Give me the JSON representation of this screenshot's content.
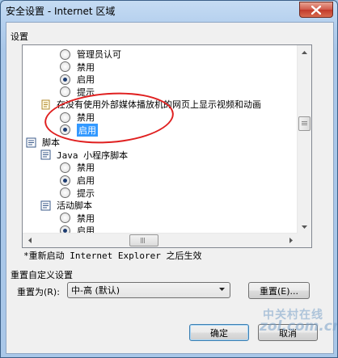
{
  "window": {
    "title": "安全设置 - Internet 区域"
  },
  "settings": {
    "group_label": "设置",
    "rows": [
      {
        "type": "radio",
        "label": "管理员认可",
        "checked": false
      },
      {
        "type": "radio",
        "label": "禁用",
        "checked": false
      },
      {
        "type": "radio",
        "label": "启用",
        "checked": true
      },
      {
        "type": "radio",
        "label": "提示",
        "checked": false
      },
      {
        "type": "setting",
        "label": "在没有使用外部媒体播放机的网页上显示视频和动画"
      },
      {
        "type": "radio",
        "label": "禁用",
        "checked": false
      },
      {
        "type": "radio",
        "label": "启用",
        "checked": true,
        "selected": true
      },
      {
        "type": "group",
        "label": "脚本"
      },
      {
        "type": "setting",
        "label": "Java 小程序脚本"
      },
      {
        "type": "radio",
        "label": "禁用",
        "checked": false
      },
      {
        "type": "radio",
        "label": "启用",
        "checked": true
      },
      {
        "type": "radio",
        "label": "提示",
        "checked": false
      },
      {
        "type": "setting",
        "label": "活动脚本"
      },
      {
        "type": "radio",
        "label": "禁用",
        "checked": false
      },
      {
        "type": "radio",
        "label": "启用",
        "checked": true
      }
    ],
    "restart_note": "*重新启动 Internet Explorer 之后生效"
  },
  "reset": {
    "group_label": "重置自定义设置",
    "reset_to_label": "重置为(R):",
    "selected_level": "中-高 (默认)",
    "reset_button": "重置(E)..."
  },
  "footer": {
    "ok_button": "确定",
    "cancel_button": "取消"
  },
  "watermark": {
    "line1": "中关村在线",
    "line2": "zol.com.cn"
  },
  "colors": {
    "selection": "#3399ff",
    "annotation": "#e02020",
    "title_bar": "#b5d0ee"
  }
}
